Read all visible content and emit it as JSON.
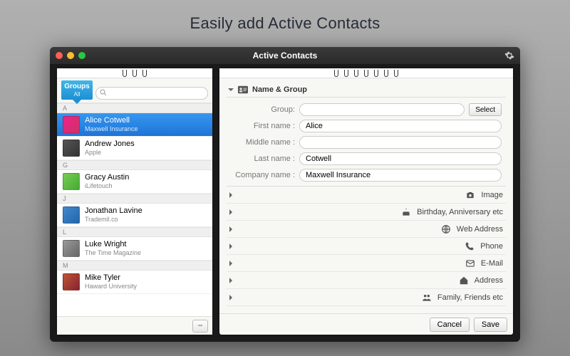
{
  "headline": "Easily add Active Contacts",
  "window": {
    "title": "Active Contacts"
  },
  "sidebar": {
    "groups_label": "Groups",
    "groups_filter": "All",
    "search_placeholder": "",
    "sections": [
      {
        "letter": "A",
        "items": [
          {
            "name": "Alice Cotwell",
            "sub": "Maxwell Insurance",
            "selected": true,
            "avatar": "av1"
          },
          {
            "name": "Andrew Jones",
            "sub": "Apple",
            "selected": false,
            "avatar": "av2"
          }
        ]
      },
      {
        "letter": "G",
        "items": [
          {
            "name": "Gracy  Austin",
            "sub": "iLifetouch",
            "selected": false,
            "avatar": "av3"
          }
        ]
      },
      {
        "letter": "J",
        "items": [
          {
            "name": "Jonathan  Lavine",
            "sub": "Trademil.co",
            "selected": false,
            "avatar": "av4"
          }
        ]
      },
      {
        "letter": "L",
        "items": [
          {
            "name": "Luke Wright",
            "sub": "The Time Magazine",
            "selected": false,
            "avatar": "av5"
          }
        ]
      },
      {
        "letter": "M",
        "items": [
          {
            "name": "Mike Tyler",
            "sub": "Haward University",
            "selected": false,
            "avatar": "av6"
          }
        ]
      }
    ]
  },
  "detail": {
    "section_title": "Name & Group",
    "labels": {
      "group": "Group:",
      "first_name": "First name :",
      "middle_name": "Middle name :",
      "last_name": "Last name :",
      "company_name": "Company name :"
    },
    "values": {
      "group": "",
      "first_name": "Alice",
      "middle_name": "",
      "last_name": "Cotwell",
      "company_name": "Maxwell Insurance"
    },
    "select_button": "Select",
    "collapsed": [
      {
        "icon": "camera",
        "label": "Image"
      },
      {
        "icon": "cake",
        "label": "Birthday, Anniversary etc"
      },
      {
        "icon": "globe",
        "label": "Web Address"
      },
      {
        "icon": "phone",
        "label": "Phone"
      },
      {
        "icon": "mail",
        "label": "E-Mail"
      },
      {
        "icon": "home",
        "label": "Address"
      },
      {
        "icon": "people",
        "label": "Family, Friends etc"
      }
    ],
    "buttons": {
      "cancel": "Cancel",
      "save": "Save"
    }
  }
}
